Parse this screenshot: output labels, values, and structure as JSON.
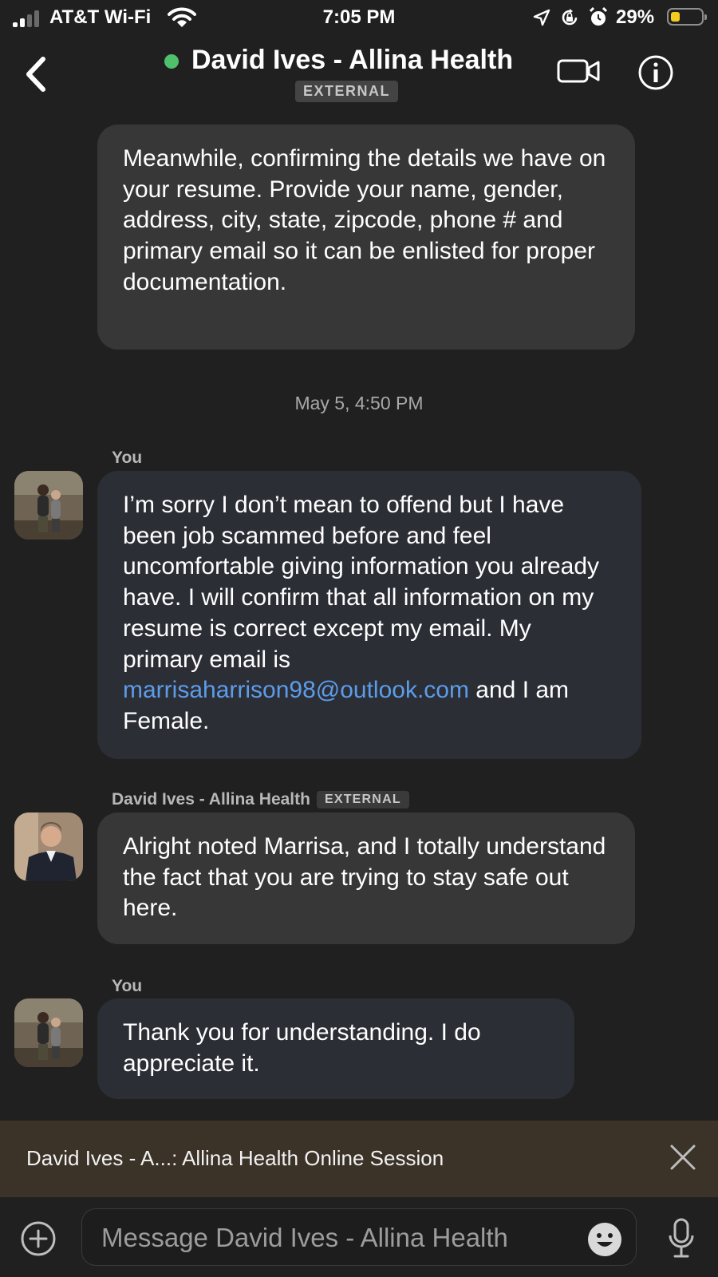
{
  "status_bar": {
    "carrier": "AT&T Wi-Fi",
    "time": "7:05 PM",
    "battery": "29%",
    "battery_level": 0.29,
    "icons": [
      "signal-icon",
      "wifi-icon",
      "location-icon",
      "rotation-lock-icon",
      "alarm-icon",
      "battery-icon"
    ]
  },
  "header": {
    "title": "David Ives - Allina Health",
    "external_badge": "EXTERNAL",
    "presence_color": "#4fc06c",
    "icons": [
      "back-icon",
      "video-call-icon",
      "info-icon"
    ]
  },
  "messages": [
    {
      "direction": "incoming",
      "text": "Meanwhile, confirming the details we have on your resume. Provide your name, gender, address, city, state, zipcode, phone # and primary email so it can be enlisted for proper documentation."
    },
    {
      "timestamp": "May 5, 4:50 PM"
    },
    {
      "direction": "outgoing",
      "sender": "You",
      "text_before": "I’m sorry I don’t mean to offend but I have been job scammed before and feel uncomfortable giving information you already have. I will confirm that all information on my resume is correct except my email. My primary email is ",
      "link": "marrisaharrison98@outlook.com",
      "text_after": " and I am Female."
    },
    {
      "direction": "incoming",
      "sender": "David Ives - Allina Health",
      "sender_badge": "EXTERNAL",
      "text": "Alright noted Marrisa, and I totally understand the fact that you are trying to stay safe out here."
    },
    {
      "direction": "outgoing",
      "sender": "You",
      "text": "Thank you for understanding. I do appreciate it."
    }
  ],
  "banner": {
    "text": "David Ives - A...: Allina Health Online Session"
  },
  "composer": {
    "placeholder": "Message David Ives - Allina Health",
    "value": ""
  },
  "colors": {
    "background": "#202020",
    "incoming_bubble": "#373737",
    "outgoing_bubble": "#2c2e36",
    "link": "#5c9dea",
    "banner": "#3b3228",
    "battery_fill": "#f4cc1f"
  }
}
